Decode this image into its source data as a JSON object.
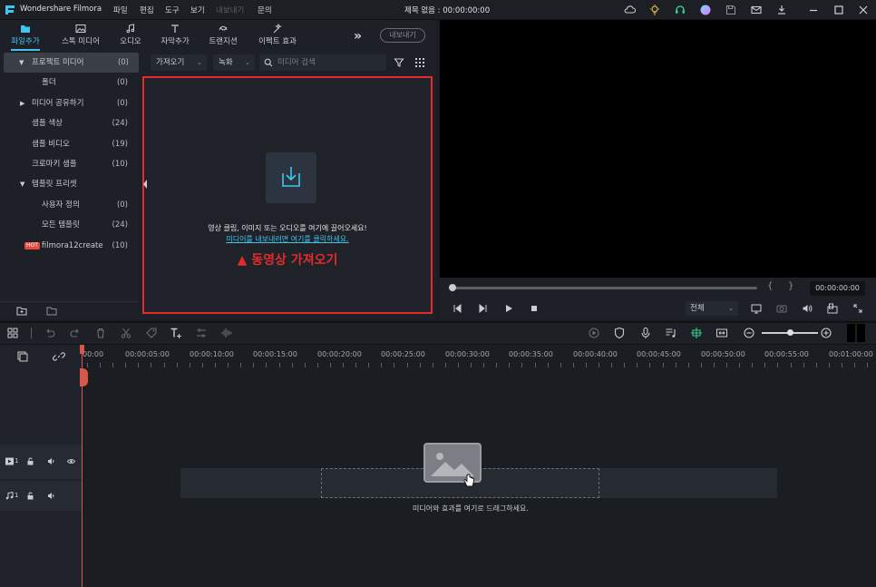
{
  "titlebar": {
    "app_name": "Wondershare Filmora",
    "menu": [
      "파일",
      "편집",
      "도구",
      "보기",
      "내보내기",
      "문의"
    ],
    "doc_title": "제목 없음 : 00:00:00:00"
  },
  "tabs": [
    "파일추가",
    "스톡 미디어",
    "오디오",
    "자막추가",
    "트랜지션",
    "이펙트 효과"
  ],
  "export_label": "내보내기",
  "sidebar": {
    "items": [
      {
        "label": "프로젝트 미디어",
        "count": "(0)"
      },
      {
        "label": "폴더",
        "count": "(0)"
      },
      {
        "label": "미디어 공유하기",
        "count": "(0)"
      },
      {
        "label": "샘플 색상",
        "count": "(24)"
      },
      {
        "label": "샘플 비디오",
        "count": "(19)"
      },
      {
        "label": "크로마키 샘플",
        "count": "(10)"
      },
      {
        "label": "템플릿 프리셋",
        "count": ""
      },
      {
        "label": "사용자 정의",
        "count": "(0)"
      },
      {
        "label": "모든 템플릿",
        "count": "(24)"
      },
      {
        "label": "filmora12create",
        "count": "(10)",
        "badge": "HOT"
      }
    ]
  },
  "media_toolbar": {
    "import_label": "가져오기",
    "record_label": "녹화",
    "search_placeholder": "미디어 검색"
  },
  "dropzone": {
    "hint": "영상 클립, 이미지 또는 오디오를 여기에 끌어오세요!",
    "link": "미디어를 내보내려면 여기를 클릭하세요.",
    "annotation": "▲ 동영상 가져오기"
  },
  "player": {
    "time": "00:00:00:00",
    "bracket_in": "{",
    "bracket_out": "}",
    "quality": "전체"
  },
  "ruler": {
    "labels": [
      "00:00",
      "00:00:05:00",
      "00:00:10:00",
      "00:00:15:00",
      "00:00:20:00",
      "00:00:25:00",
      "00:00:30:00",
      "00:00:35:00",
      "00:00:40:00",
      "00:00:45:00",
      "00:00:50:00",
      "00:00:55:00",
      "00:01:00:00"
    ]
  },
  "tracks": {
    "video_index": "1",
    "audio_index": "1"
  },
  "timeline_hint": "미디어와 효과를 여기로 드래그하세요.",
  "colors": {
    "accent": "#3fc5f0",
    "annotation": "#e32b2b",
    "playhead": "#d9574a",
    "hot_badge": "#e5493f"
  }
}
